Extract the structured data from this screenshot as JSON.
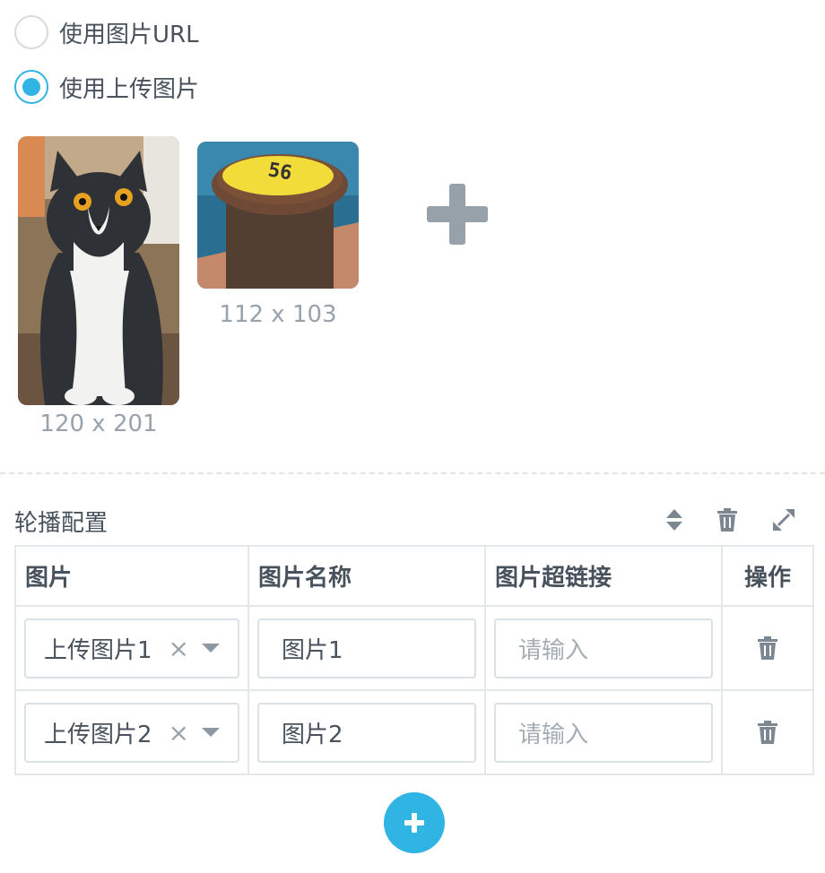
{
  "image_source": {
    "options": [
      {
        "label": "使用图片URL",
        "checked": false
      },
      {
        "label": "使用上传图片",
        "checked": true
      }
    ]
  },
  "images": [
    {
      "size_label": "120 x 201",
      "subject": "gray-and-white cat"
    },
    {
      "size_label": "112 x 103",
      "subject": "yellow-top mooring bollard numbered 56"
    }
  ],
  "carousel": {
    "title": "轮播配置",
    "columns": [
      "图片",
      "图片名称",
      "图片超链接",
      "操作"
    ],
    "rows": [
      {
        "image": "上传图片1",
        "name": "图片1",
        "link": "",
        "link_placeholder": "请输入"
      },
      {
        "image": "上传图片2",
        "name": "图片2",
        "link": "",
        "link_placeholder": "请输入"
      }
    ]
  },
  "icons": {
    "add_image": "plus-icon",
    "sort": "sort-icon",
    "delete": "trash-icon",
    "expand": "expand-icon",
    "add_row": "plus-circle-icon"
  },
  "colors": {
    "accent": "#2fb4e4",
    "text": "#48525c",
    "muted": "#98a2ad",
    "border": "#e4e8eb"
  }
}
